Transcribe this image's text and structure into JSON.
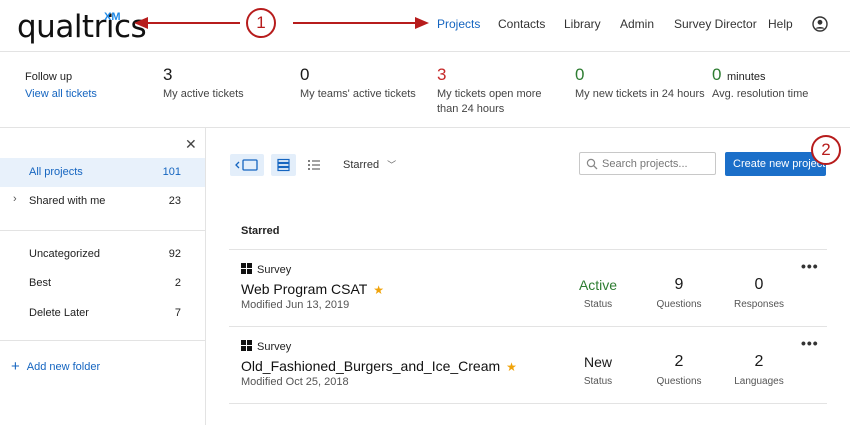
{
  "header": {
    "logo": "qualtrics",
    "logo_sup": "XM",
    "nav": {
      "projects": "Projects",
      "contacts": "Contacts",
      "library": "Library",
      "admin": "Admin",
      "survey_director": "Survey Director",
      "help": "Help"
    },
    "icons": {
      "user": "user-circle-icon"
    }
  },
  "callouts": {
    "one": "1",
    "two": "2"
  },
  "stats": {
    "follow_up": "Follow up",
    "view_all": "View all tickets",
    "items": [
      {
        "value": "3",
        "label": "My active tickets"
      },
      {
        "value": "0",
        "label": "My teams' active tickets"
      },
      {
        "value": "3",
        "label": "My tickets open more than 24 hours"
      },
      {
        "value": "0",
        "label": "My new tickets in 24 hours"
      },
      {
        "value": "0",
        "unit": "minutes",
        "label": "Avg. resolution time"
      }
    ],
    "colors": {
      "alert": "#c62828",
      "good": "#2e7d32"
    }
  },
  "sidebar": {
    "close_icon": "close-icon",
    "all_projects": {
      "label": "All projects",
      "count": "101"
    },
    "shared": {
      "label": "Shared with me",
      "count": "23"
    },
    "folders": [
      {
        "label": "Uncategorized",
        "count": "92"
      },
      {
        "label": "Best",
        "count": "2"
      },
      {
        "label": "Delete Later",
        "count": "7"
      }
    ],
    "add_folder": "Add new folder"
  },
  "toolbar": {
    "sort_label": "Starred",
    "search_placeholder": "Search projects...",
    "create_label": "Create new project"
  },
  "list": {
    "section": "Starred",
    "projects": [
      {
        "type": "Survey",
        "name": "Web Program CSAT",
        "modified": "Modified Jun 13, 2019",
        "status_value": "Active",
        "status_label": "Status",
        "m2_value": "9",
        "m2_label": "Questions",
        "m3_value": "0",
        "m3_label": "Responses"
      },
      {
        "type": "Survey",
        "name": "Old_Fashioned_Burgers_and_Ice_Cream",
        "modified": "Modified Oct 25, 2018",
        "status_value": "New",
        "status_label": "Status",
        "m2_value": "2",
        "m2_label": "Questions",
        "m3_value": "2",
        "m3_label": "Languages"
      }
    ],
    "star_glyph": "★",
    "more_glyph": "•••",
    "accent": "#1b6fc9"
  }
}
